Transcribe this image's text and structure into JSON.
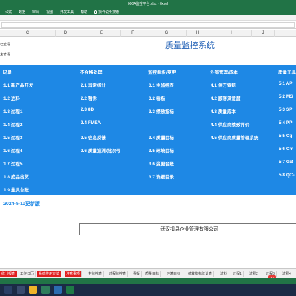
{
  "window": {
    "title": "000A监控平台.xlsx - Excel",
    "ribbon_tabs": [
      "公式",
      "数据",
      "审阅",
      "视图",
      "开发工具",
      "帮助"
    ],
    "tell_me": "操作说明搜索"
  },
  "columns": [
    "C",
    "D",
    "E",
    "F",
    "G",
    "H",
    "I",
    "J"
  ],
  "sheet": {
    "status_checked": "已查看",
    "status_unchecked": "未查看",
    "title": "质量监控系统",
    "update_note": "2024-5-10更新版",
    "company": "武汉扣易企业管理有限公司",
    "headers": [
      "记录",
      "不合格处理",
      "监控看板/变更",
      "外部管理/成本",
      "质量工具"
    ],
    "col1": [
      "1.1 新产品开发",
      "1.2 进料",
      "1.3 过程1",
      "1.4 过程2",
      "1.5 过程3",
      "1.6 过程4",
      "1.7 过程5",
      "1.8 成品出货",
      "1.9 量具台账"
    ],
    "col2": [
      "2.1 异常统计",
      "2.2 客诉",
      "2.3 8D",
      "2.4 FMEA",
      "2.5 信息反馈",
      "2.6 质量追溯/批次号"
    ],
    "col3": [
      "3.1 主监控表",
      "3.2 看板",
      "3.3 绩效指标",
      "3.4 质量目标",
      "3.5 环境目标",
      "3.6 变更台账",
      "3.7 详细目录"
    ],
    "col4": [
      "4.1 供方索赔",
      "4.2 顾客满意度",
      "4.3 质量成本",
      "4.4 供应商绩效评价",
      "4.5 供应商质量管理系统"
    ],
    "col5": [
      "5.1 AP",
      "5.2 MS",
      "5.3 SP",
      "5.4 PP",
      "5.5 Cg",
      "5.6 Cm",
      "5.7 GB",
      "5.8 QC-"
    ]
  },
  "sheet_tabs": [
    "统计报表",
    "工作日历",
    "系统使用方法",
    "注意事项",
    "主监控表",
    "过程监控表",
    "看板",
    "质量目标",
    "环境目标",
    "绩效指标统计表",
    "过料",
    "过程1",
    "过程2",
    "过程3",
    "过程4"
  ],
  "red_tabs": [
    0,
    2,
    3
  ],
  "logo": "S",
  "colors": {
    "excel_green": "#217346",
    "panel_blue": "#1e88e5",
    "tab_red": "#e02020"
  },
  "taskbar_icons": [
    "start-icon",
    "search-icon",
    "file-explorer-icon",
    "browser-icon",
    "app-icon",
    "excel-icon"
  ]
}
